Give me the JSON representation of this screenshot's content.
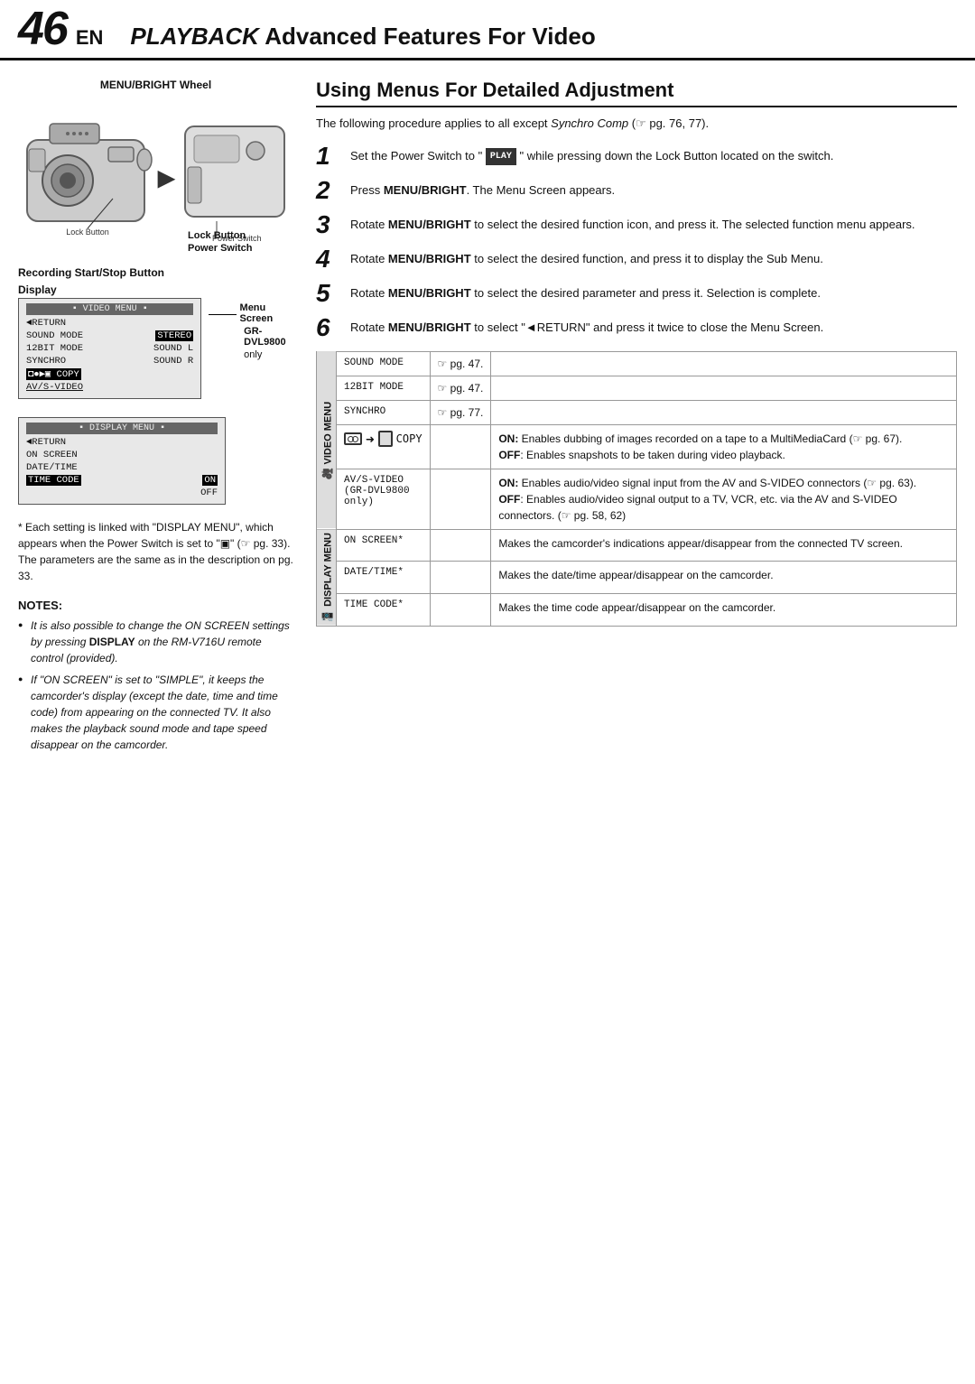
{
  "header": {
    "page_num": "46",
    "page_suffix": "EN",
    "title_playback": "PLAYBACK",
    "title_rest": " Advanced Features For Video"
  },
  "left_col": {
    "camera_label": "MENU/BRIGHT Wheel",
    "lock_button_label": "Lock Button",
    "power_switch_label": "Power Switch",
    "recording_button_label": "Recording Start/Stop Button",
    "display_label": "Display",
    "video_menu": {
      "header": "VIDEO MENU",
      "rows": [
        {
          "left": "◄RETURN",
          "right": ""
        },
        {
          "left": "SOUND MODE",
          "right": "STEREO"
        },
        {
          "left": "12BIT MODE",
          "right": "SOUND L"
        },
        {
          "left": "SYNCHRO",
          "right": "SOUND R"
        },
        {
          "left": "◘●▶▣ COPY",
          "right": "",
          "highlight": true
        },
        {
          "left": "AV/S-VIDEO",
          "right": "",
          "underline": true
        }
      ],
      "side_label": "Menu Screen",
      "gr_label": "GR-DVL9800",
      "gr_only": "only"
    },
    "display_menu": {
      "header": "DISPLAY MENU",
      "rows": [
        {
          "left": "◄RETURN",
          "right": ""
        },
        {
          "left": "ON SCREEN",
          "right": ""
        },
        {
          "left": "DATE/TIME",
          "right": ""
        },
        {
          "left": "TIME CODE",
          "right": "ON",
          "highlight": true
        },
        {
          "left": "",
          "right": "OFF"
        }
      ]
    },
    "asterisk_note": "* Each setting is linked with \"DISPLAY MENU\", which appears when the Power Switch is set to \"▣\" (☞ pg. 33). The parameters are the same as in the description on pg. 33.",
    "notes_title": "NOTES:",
    "notes": [
      "It is also possible to change the ON SCREEN settings by pressing DISPLAY on the RM-V716U remote control (provided).",
      "If \"ON SCREEN\" is set to \"SIMPLE\", it keeps the camcorder's display (except the date, time and time code) from appearing on the connected TV. It also makes the playback sound mode and tape speed disappear on the camcorder."
    ]
  },
  "right_col": {
    "section_heading": "Using Menus For Detailed Adjustment",
    "intro": "The following procedure applies to all except Synchro Comp (☞ pg. 76, 77).",
    "steps": [
      {
        "num": "1",
        "text": "Set the Power Switch to \" PLAY \" while pressing down the Lock Button located on the switch."
      },
      {
        "num": "2",
        "text": "Press MENU/BRIGHT. The Menu Screen appears."
      },
      {
        "num": "3",
        "text": "Rotate MENU/BRIGHT to select the desired function icon, and press it. The selected function menu appears."
      },
      {
        "num": "4",
        "text": "Rotate MENU/BRIGHT to select the desired function, and press it to display the Sub Menu."
      },
      {
        "num": "5",
        "text": "Rotate MENU/BRIGHT to select the desired parameter and press it. Selection is complete."
      },
      {
        "num": "6",
        "text": "Rotate MENU/BRIGHT to select \"◄RETURN\" and press it twice to close the Menu Screen."
      }
    ],
    "table": {
      "video_menu_header": "VIDEO MENU",
      "display_menu_header": "DISPLAY MENU",
      "rows": [
        {
          "section": "video",
          "label": "SOUND MODE",
          "ref": "☞ pg. 47.",
          "desc": ""
        },
        {
          "section": "video",
          "label": "12BIT MODE",
          "ref": "☞ pg. 47.",
          "desc": ""
        },
        {
          "section": "video",
          "label": "SYNCHRO",
          "ref": "☞ pg. 77.",
          "desc": ""
        },
        {
          "section": "video",
          "label": "◘ ➜ ▣ COPY",
          "ref": "",
          "desc": "ON: Enables dubbing of images recorded on a tape to a MultiMediaCard (☞ pg. 67).\nOFF: Enables snapshots to be taken during video playback."
        },
        {
          "section": "video",
          "label": "AV/S-VIDEO\n(GR-DVL9800\nonly)",
          "ref": "",
          "desc": "ON: Enables audio/video signal input from the AV and S-VIDEO connectors (☞ pg. 63).\nOFF: Enables audio/video signal output to a TV, VCR, etc. via the AV and S-VIDEO connectors. (☞ pg. 58, 62)"
        },
        {
          "section": "display",
          "label": "ON SCREEN*",
          "ref": "",
          "desc": "Makes the camcorder's indications appear/disappear from the connected TV screen."
        },
        {
          "section": "display",
          "label": "DATE/TIME*",
          "ref": "",
          "desc": "Makes the date/time appear/disappear on the camcorder."
        },
        {
          "section": "display",
          "label": "TIME CODE*",
          "ref": "",
          "desc": "Makes the time code appear/disappear on the camcorder."
        }
      ]
    }
  }
}
